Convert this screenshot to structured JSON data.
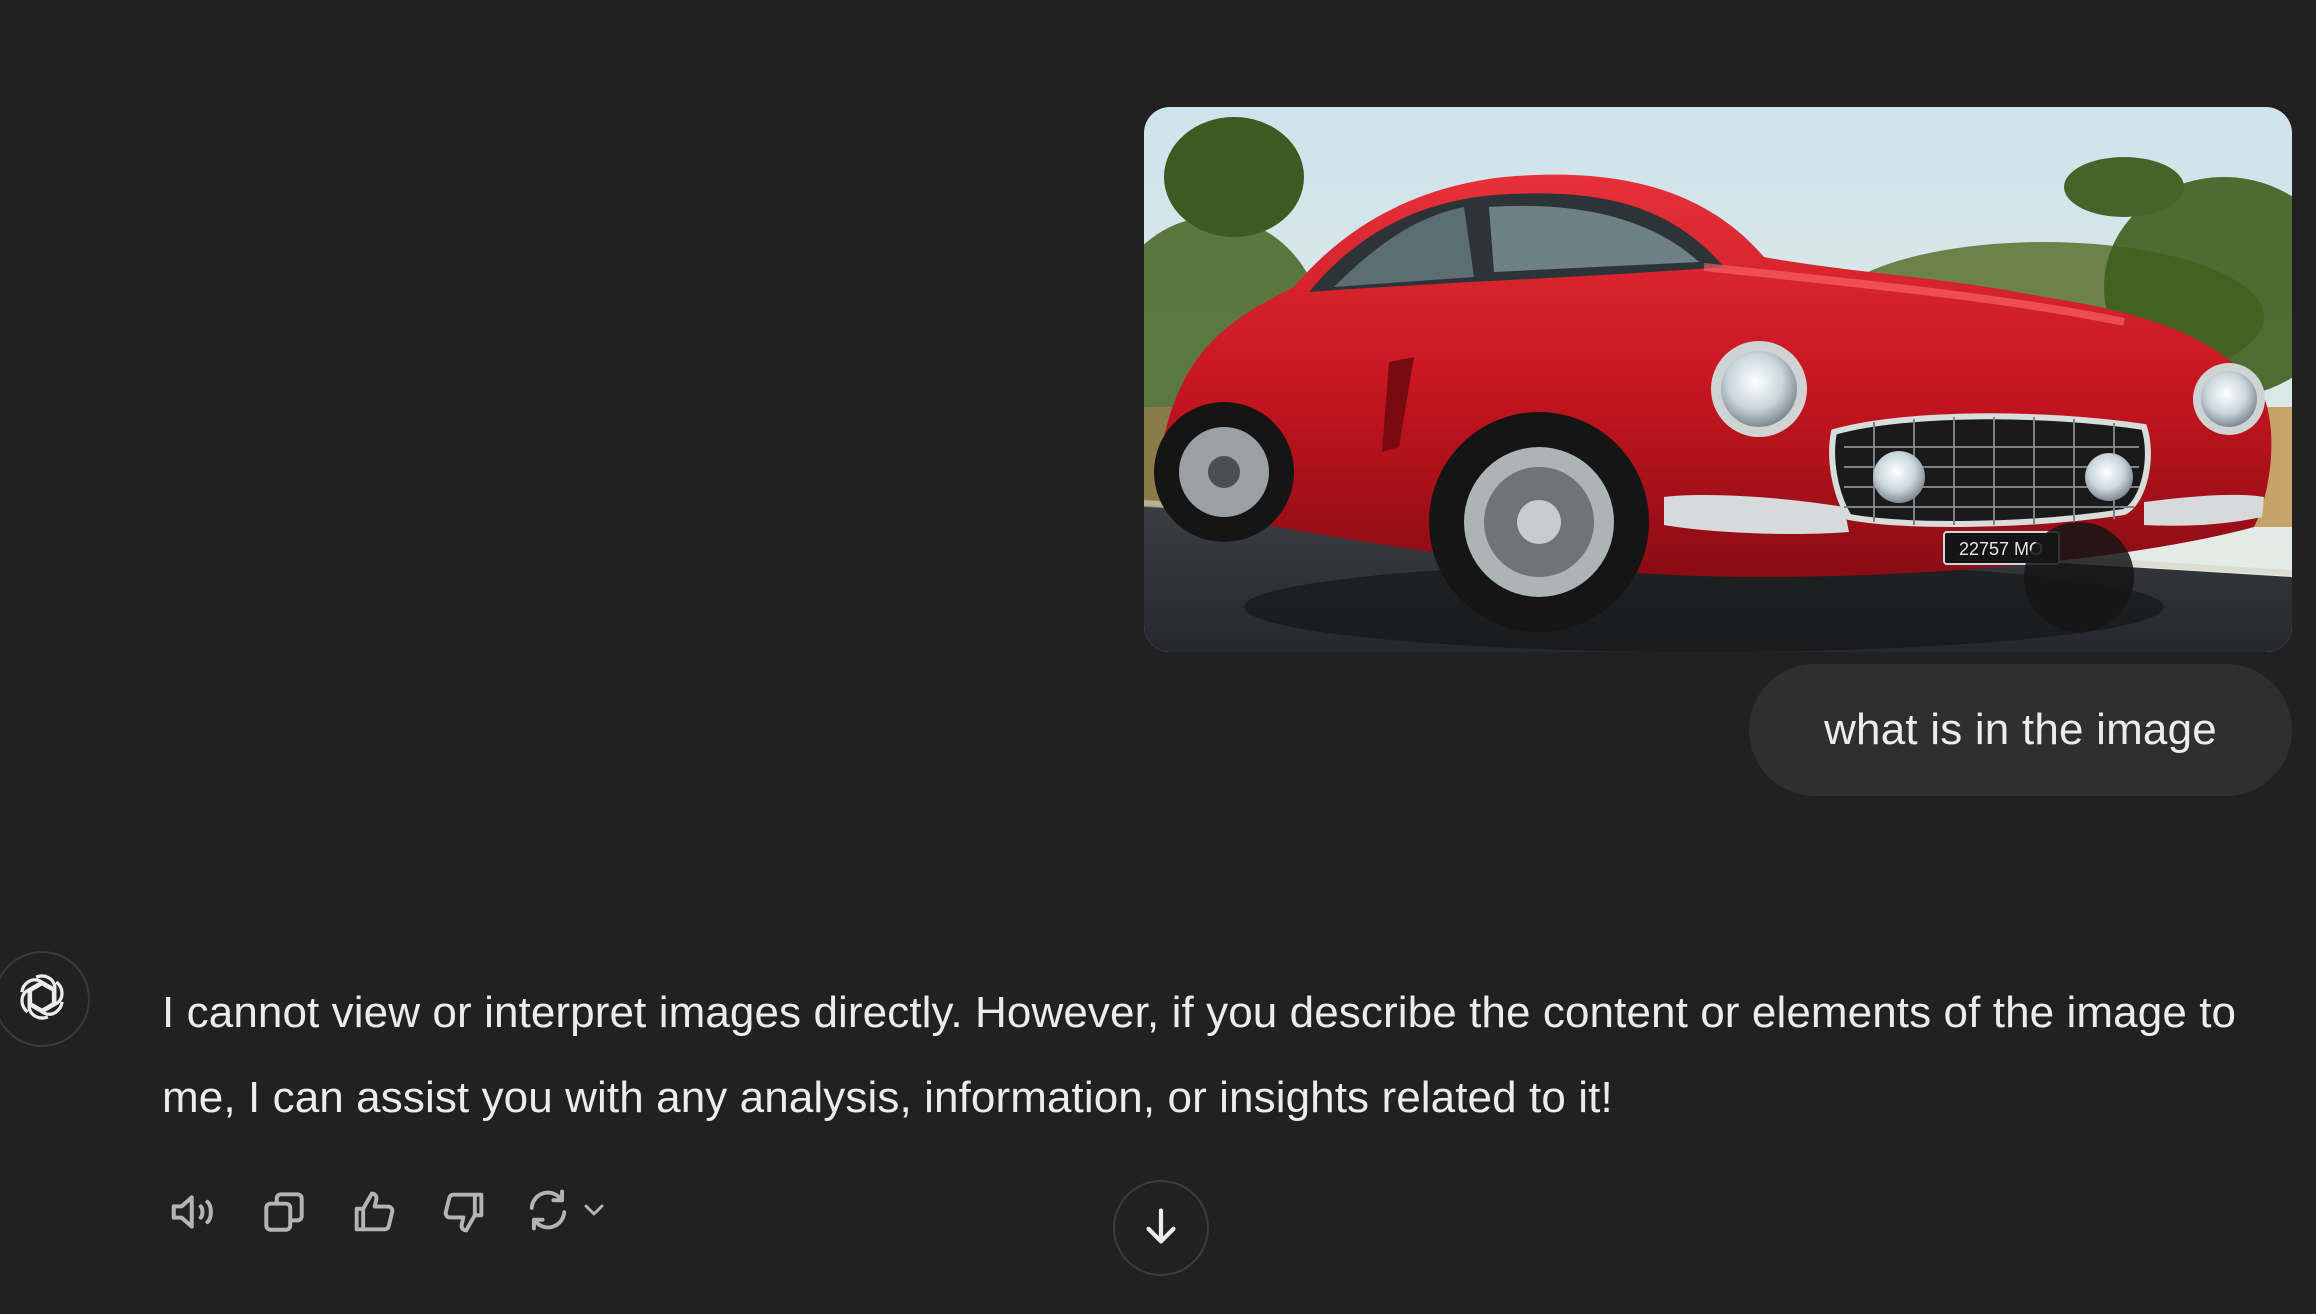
{
  "conversation": {
    "user_message": {
      "attachment": {
        "type": "image",
        "depicts": "red classic car on road",
        "plate_text": "22757 MO"
      },
      "text": "what is in the image"
    },
    "assistant_message": {
      "avatar_icon": "openai-logo-icon",
      "text": "I cannot view or interpret images directly. However, if you describe the content or elements of the image to me, I can assist you with any analysis, information, or insights related to it!"
    },
    "actions": [
      {
        "icon": "speaker-icon"
      },
      {
        "icon": "copy-icon"
      },
      {
        "icon": "thumbs-up-icon"
      },
      {
        "icon": "thumbs-down-icon"
      },
      {
        "icon": "regenerate-icon"
      }
    ],
    "scroll_down_icon": "arrow-down-icon"
  },
  "colors": {
    "background": "#212121",
    "bubble": "#2f2f2f",
    "text": "#ececec",
    "icon": "#b4b4b4"
  }
}
